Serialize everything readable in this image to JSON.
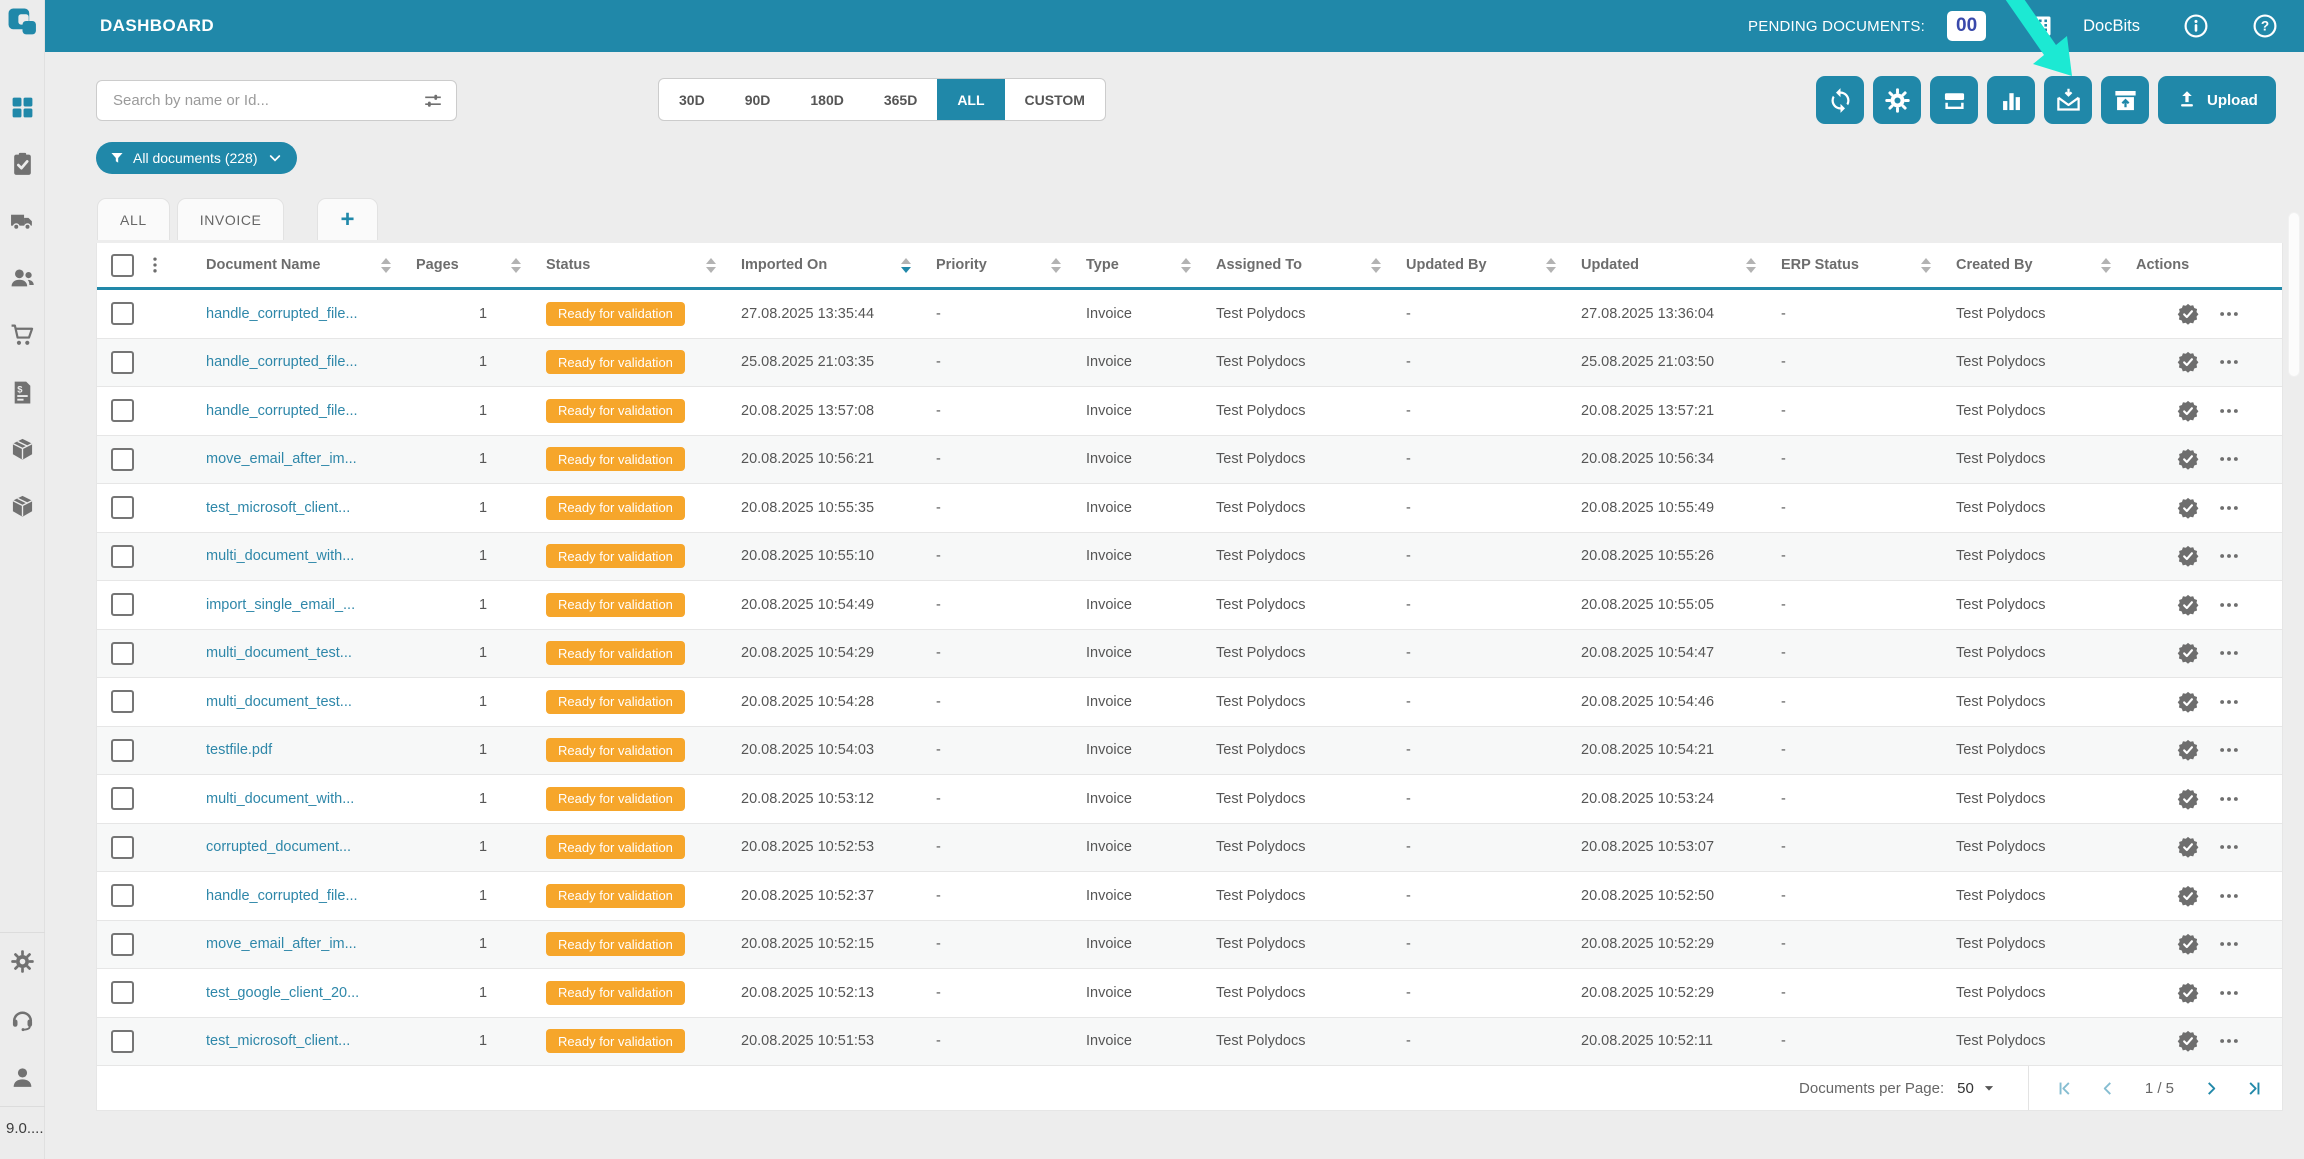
{
  "colors": {
    "primary": "#2088a9",
    "status_badge": "#f6a62b",
    "link": "#2e87a9",
    "pending_count_text": "#3949ab",
    "annotation_arrow": "#1ce9d3",
    "sorted_arrow": "#2188a9"
  },
  "header": {
    "title": "DASHBOARD",
    "pending_label": "PENDING DOCUMENTS:",
    "pending_count": "00",
    "brand": "DocBits"
  },
  "sidebar": {
    "version": "9.0....",
    "items": [
      {
        "icon": "grid",
        "name": "dashboard",
        "active": true
      },
      {
        "icon": "clipboard-check",
        "name": "approvals",
        "active": false
      },
      {
        "icon": "truck",
        "name": "shipments",
        "active": false
      },
      {
        "icon": "users",
        "name": "users",
        "active": false
      },
      {
        "icon": "cart",
        "name": "purchase-orders",
        "active": false
      },
      {
        "icon": "invoice",
        "name": "invoices",
        "active": false
      },
      {
        "icon": "package",
        "name": "packages",
        "active": false
      },
      {
        "icon": "package",
        "name": "inventory",
        "active": false
      }
    ],
    "bottom_items": [
      {
        "icon": "gear",
        "name": "settings"
      },
      {
        "icon": "headset",
        "name": "support"
      },
      {
        "icon": "person",
        "name": "profile"
      }
    ]
  },
  "toolbar": {
    "search_placeholder": "Search by name or Id...",
    "date_ranges": [
      "30D",
      "90D",
      "180D",
      "365D",
      "ALL",
      "CUSTOM"
    ],
    "active_range": "ALL",
    "buttons": [
      {
        "icon": "refresh",
        "name": "refresh"
      },
      {
        "icon": "gear",
        "name": "settings"
      },
      {
        "icon": "scanner",
        "name": "scan"
      },
      {
        "icon": "bar-chart",
        "name": "analytics"
      },
      {
        "icon": "mail-import",
        "name": "mail-import"
      },
      {
        "icon": "box-upload",
        "name": "export"
      }
    ],
    "upload_label": "Upload"
  },
  "filter_chip": {
    "label": "All documents (228)"
  },
  "tabs": [
    {
      "label": "ALL",
      "is_add": false
    },
    {
      "label": "INVOICE",
      "is_add": false
    },
    {
      "label": "+",
      "is_add": true
    }
  ],
  "table": {
    "columns": [
      {
        "label": "Document Name",
        "sorted": ""
      },
      {
        "label": "Pages",
        "sorted": ""
      },
      {
        "label": "Status",
        "sorted": ""
      },
      {
        "label": "Imported On",
        "sorted": "desc"
      },
      {
        "label": "Priority",
        "sorted": ""
      },
      {
        "label": "Type",
        "sorted": ""
      },
      {
        "label": "Assigned To",
        "sorted": ""
      },
      {
        "label": "Updated By",
        "sorted": ""
      },
      {
        "label": "Updated",
        "sorted": ""
      },
      {
        "label": "ERP Status",
        "sorted": ""
      },
      {
        "label": "Created By",
        "sorted": ""
      },
      {
        "label": "Actions",
        "sortable": false
      }
    ],
    "rows": [
      {
        "name": "handle_corrupted_file...",
        "pages": "1",
        "status": "Ready for validation",
        "imported_on": "27.08.2025 13:35:44",
        "priority": "-",
        "type": "Invoice",
        "assigned_to": "Test Polydocs",
        "updated_by": "-",
        "updated": "27.08.2025 13:36:04",
        "erp_status": "-",
        "created_by": "Test Polydocs"
      },
      {
        "name": "handle_corrupted_file...",
        "pages": "1",
        "status": "Ready for validation",
        "imported_on": "25.08.2025 21:03:35",
        "priority": "-",
        "type": "Invoice",
        "assigned_to": "Test Polydocs",
        "updated_by": "-",
        "updated": "25.08.2025 21:03:50",
        "erp_status": "-",
        "created_by": "Test Polydocs"
      },
      {
        "name": "handle_corrupted_file...",
        "pages": "1",
        "status": "Ready for validation",
        "imported_on": "20.08.2025 13:57:08",
        "priority": "-",
        "type": "Invoice",
        "assigned_to": "Test Polydocs",
        "updated_by": "-",
        "updated": "20.08.2025 13:57:21",
        "erp_status": "-",
        "created_by": "Test Polydocs"
      },
      {
        "name": "move_email_after_im...",
        "pages": "1",
        "status": "Ready for validation",
        "imported_on": "20.08.2025 10:56:21",
        "priority": "-",
        "type": "Invoice",
        "assigned_to": "Test Polydocs",
        "updated_by": "-",
        "updated": "20.08.2025 10:56:34",
        "erp_status": "-",
        "created_by": "Test Polydocs"
      },
      {
        "name": "test_microsoft_client...",
        "pages": "1",
        "status": "Ready for validation",
        "imported_on": "20.08.2025 10:55:35",
        "priority": "-",
        "type": "Invoice",
        "assigned_to": "Test Polydocs",
        "updated_by": "-",
        "updated": "20.08.2025 10:55:49",
        "erp_status": "-",
        "created_by": "Test Polydocs"
      },
      {
        "name": "multi_document_with...",
        "pages": "1",
        "status": "Ready for validation",
        "imported_on": "20.08.2025 10:55:10",
        "priority": "-",
        "type": "Invoice",
        "assigned_to": "Test Polydocs",
        "updated_by": "-",
        "updated": "20.08.2025 10:55:26",
        "erp_status": "-",
        "created_by": "Test Polydocs"
      },
      {
        "name": "import_single_email_...",
        "pages": "1",
        "status": "Ready for validation",
        "imported_on": "20.08.2025 10:54:49",
        "priority": "-",
        "type": "Invoice",
        "assigned_to": "Test Polydocs",
        "updated_by": "-",
        "updated": "20.08.2025 10:55:05",
        "erp_status": "-",
        "created_by": "Test Polydocs"
      },
      {
        "name": "multi_document_test...",
        "pages": "1",
        "status": "Ready for validation",
        "imported_on": "20.08.2025 10:54:29",
        "priority": "-",
        "type": "Invoice",
        "assigned_to": "Test Polydocs",
        "updated_by": "-",
        "updated": "20.08.2025 10:54:47",
        "erp_status": "-",
        "created_by": "Test Polydocs"
      },
      {
        "name": "multi_document_test...",
        "pages": "1",
        "status": "Ready for validation",
        "imported_on": "20.08.2025 10:54:28",
        "priority": "-",
        "type": "Invoice",
        "assigned_to": "Test Polydocs",
        "updated_by": "-",
        "updated": "20.08.2025 10:54:46",
        "erp_status": "-",
        "created_by": "Test Polydocs"
      },
      {
        "name": "testfile.pdf",
        "pages": "1",
        "status": "Ready for validation",
        "imported_on": "20.08.2025 10:54:03",
        "priority": "-",
        "type": "Invoice",
        "assigned_to": "Test Polydocs",
        "updated_by": "-",
        "updated": "20.08.2025 10:54:21",
        "erp_status": "-",
        "created_by": "Test Polydocs"
      },
      {
        "name": "multi_document_with...",
        "pages": "1",
        "status": "Ready for validation",
        "imported_on": "20.08.2025 10:53:12",
        "priority": "-",
        "type": "Invoice",
        "assigned_to": "Test Polydocs",
        "updated_by": "-",
        "updated": "20.08.2025 10:53:24",
        "erp_status": "-",
        "created_by": "Test Polydocs"
      },
      {
        "name": "corrupted_document...",
        "pages": "1",
        "status": "Ready for validation",
        "imported_on": "20.08.2025 10:52:53",
        "priority": "-",
        "type": "Invoice",
        "assigned_to": "Test Polydocs",
        "updated_by": "-",
        "updated": "20.08.2025 10:53:07",
        "erp_status": "-",
        "created_by": "Test Polydocs"
      },
      {
        "name": "handle_corrupted_file...",
        "pages": "1",
        "status": "Ready for validation",
        "imported_on": "20.08.2025 10:52:37",
        "priority": "-",
        "type": "Invoice",
        "assigned_to": "Test Polydocs",
        "updated_by": "-",
        "updated": "20.08.2025 10:52:50",
        "erp_status": "-",
        "created_by": "Test Polydocs"
      },
      {
        "name": "move_email_after_im...",
        "pages": "1",
        "status": "Ready for validation",
        "imported_on": "20.08.2025 10:52:15",
        "priority": "-",
        "type": "Invoice",
        "assigned_to": "Test Polydocs",
        "updated_by": "-",
        "updated": "20.08.2025 10:52:29",
        "erp_status": "-",
        "created_by": "Test Polydocs"
      },
      {
        "name": "test_google_client_20...",
        "pages": "1",
        "status": "Ready for validation",
        "imported_on": "20.08.2025 10:52:13",
        "priority": "-",
        "type": "Invoice",
        "assigned_to": "Test Polydocs",
        "updated_by": "-",
        "updated": "20.08.2025 10:52:29",
        "erp_status": "-",
        "created_by": "Test Polydocs"
      },
      {
        "name": "test_microsoft_client...",
        "pages": "1",
        "status": "Ready for validation",
        "imported_on": "20.08.2025 10:51:53",
        "priority": "-",
        "type": "Invoice",
        "assigned_to": "Test Polydocs",
        "updated_by": "-",
        "updated": "20.08.2025 10:52:11",
        "erp_status": "-",
        "created_by": "Test Polydocs"
      }
    ]
  },
  "pagination": {
    "per_page_label": "Documents per Page:",
    "per_page_value": "50",
    "page_indicator": "1 / 5"
  }
}
